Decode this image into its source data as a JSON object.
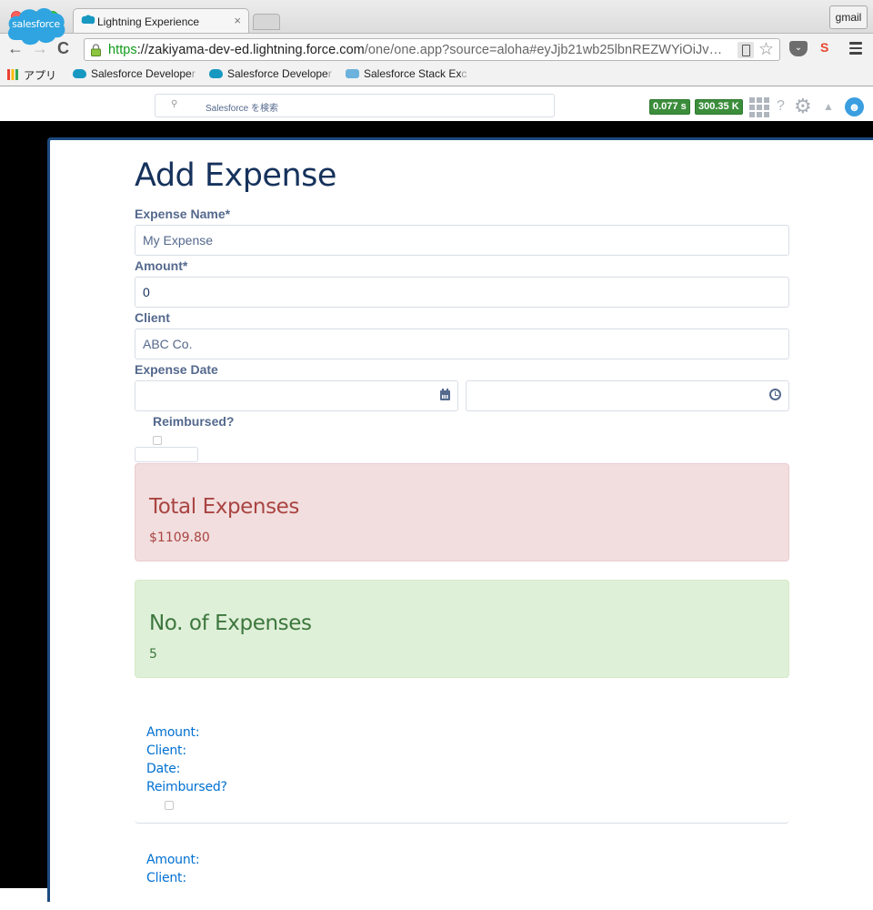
{
  "browser": {
    "tab_title": "Lightning Experience",
    "tab_close": "×",
    "profile_button": "gmail",
    "url_scheme": "https",
    "url_host": "://zakiyama-dev-ed.lightning.force.com",
    "url_rest": "/one/one.app?source=aloha#eyJjb21wb25lbnREZWYiOiJv…",
    "nav": {
      "back": "←",
      "forward": "→",
      "reload": "C"
    },
    "bookmarks": [
      {
        "label": "アプリ",
        "icon": "apps-grid-icon"
      },
      {
        "label": "Salesforce Develope",
        "fade": "r",
        "icon": "salesforce-cloud-icon"
      },
      {
        "label": "Salesforce Develope",
        "fade": "r",
        "icon": "salesforce-cloud-icon"
      },
      {
        "label": "Salesforce Stack Ex",
        "fade": "c",
        "icon": "stack-exchange-icon"
      }
    ],
    "extensions": {
      "pocket": "⌄",
      "ext": "S"
    }
  },
  "header": {
    "logo_text": "salesforce",
    "search_placeholder": "Salesforce を検索",
    "badges": [
      "0.077 s",
      "300.35 K"
    ],
    "help": "?",
    "gear": "⚙",
    "bell": "🔔",
    "avatar": "☻"
  },
  "form": {
    "title": "Add Expense",
    "fields": {
      "name_label": "Expense Name*",
      "name_value": "My Expense",
      "amount_label": "Amount*",
      "amount_value": "0",
      "client_label": "Client",
      "client_value": "ABC Co.",
      "date_label": "Expense Date",
      "date_value": "",
      "time_value": "",
      "reimbursed_label": "Reimbursed?",
      "reimbursed_checked": false
    }
  },
  "summary": {
    "total_title": "Total Expenses",
    "total_value": "$1109.80",
    "count_title": "No. of Expenses",
    "count_value": "5",
    "colors": {
      "danger_bg": "#f2dede",
      "danger_text": "#a94442",
      "success_bg": "#dff0d8",
      "success_text": "#3c763d"
    }
  },
  "expenses": [
    {
      "amount_label": "Amount:",
      "client_label": "Client:",
      "date_label": "Date:",
      "reimbursed_label": "Reimbursed?",
      "reimbursed": false
    },
    {
      "amount_label": "Amount:",
      "client_label": "Client:"
    }
  ]
}
